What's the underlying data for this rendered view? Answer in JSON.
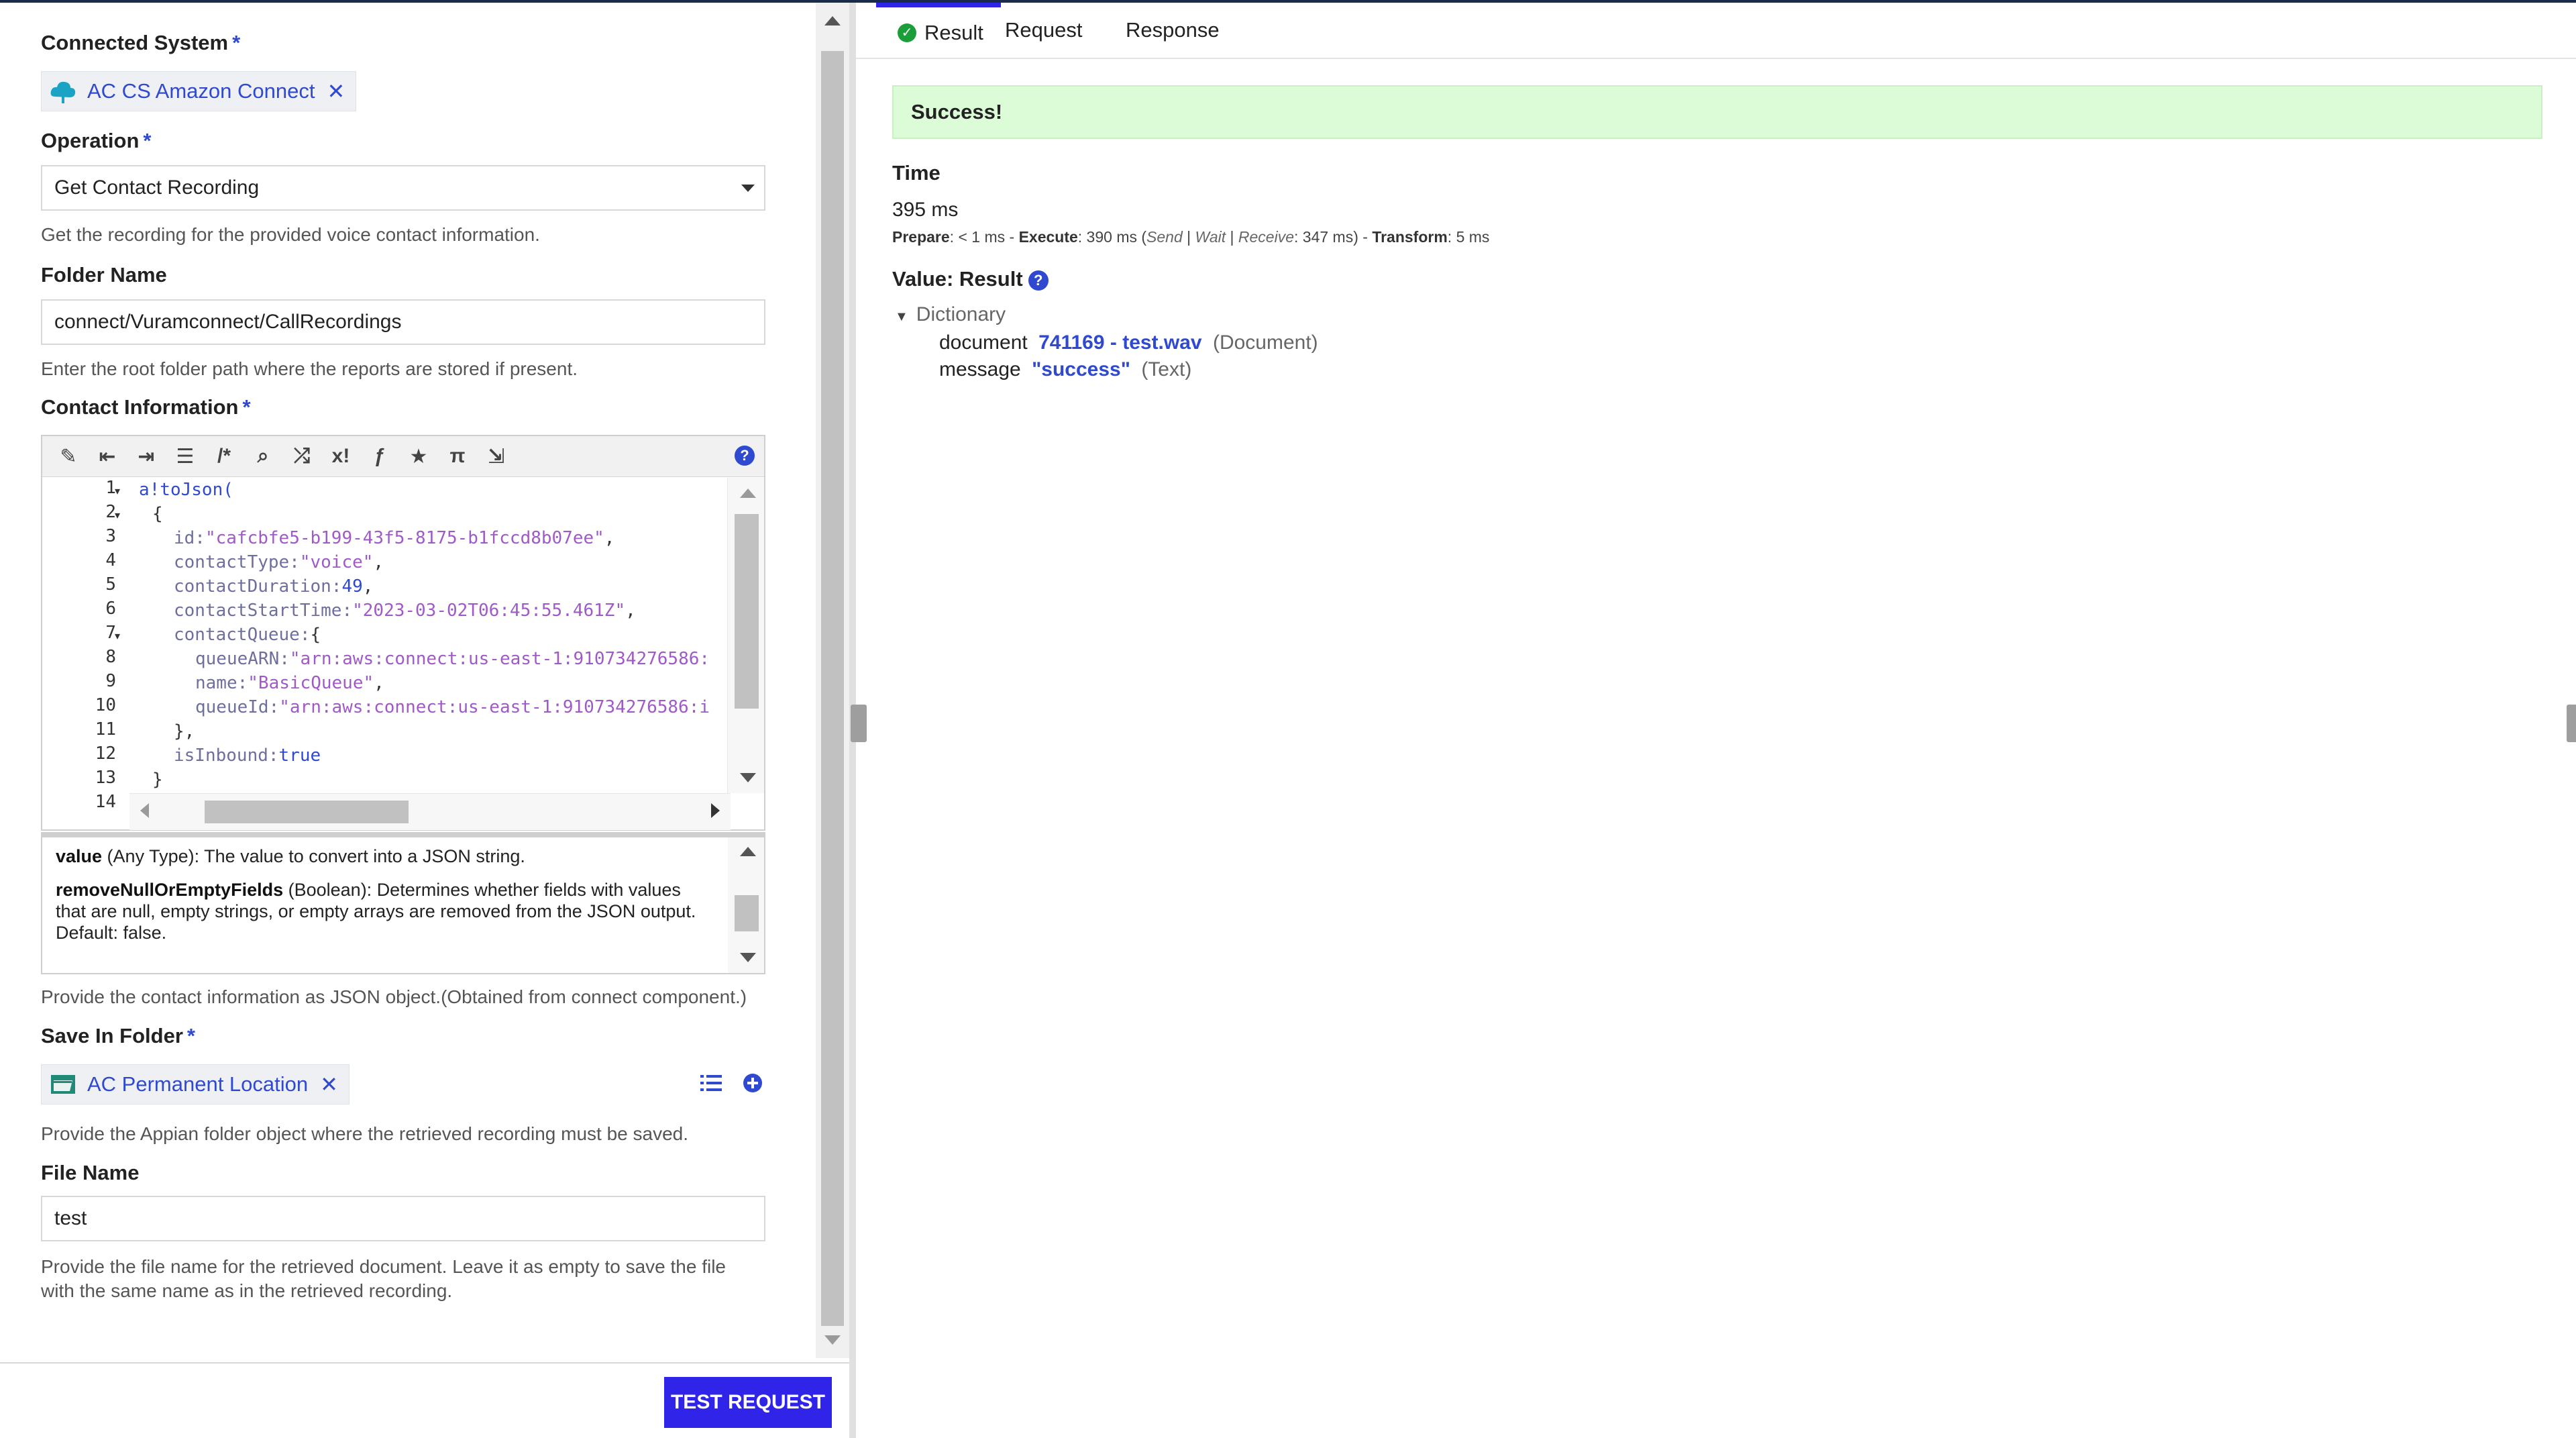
{
  "left": {
    "connected_system": {
      "label": "Connected System",
      "required": "*",
      "value": "AC CS Amazon Connect"
    },
    "operation": {
      "label": "Operation",
      "required": "*",
      "value": "Get Contact Recording",
      "help": "Get the recording for the provided voice contact information."
    },
    "folder_name": {
      "label": "Folder Name",
      "value": "connect/Vuramconnect/CallRecordings",
      "help": "Enter the root folder path where the reports are stored if present."
    },
    "contact_information": {
      "label": "Contact Information",
      "required": "*",
      "toolbar": [
        "wand-icon",
        "outdent-icon",
        "indent-icon",
        "list-icon",
        "comment-icon",
        "search-icon",
        "shuffle-icon",
        "variable-icon",
        "function-icon",
        "star-icon",
        "pi-icon",
        "export-icon"
      ],
      "line_numbers": [
        "1",
        "2",
        "3",
        "4",
        "5",
        "6",
        "7",
        "8",
        "9",
        "10",
        "11",
        "12",
        "13",
        "14"
      ],
      "code": {
        "l1": "a!toJson(",
        "l2": "{",
        "l3_key": "id:",
        "l3_val": "\"cafcbfe5-b199-43f5-8175-b1fccd8b07ee\"",
        "l3_end": ",",
        "l4_key": "contactType:",
        "l4_val": "\"voice\"",
        "l4_end": ",",
        "l5_key": "contactDuration:",
        "l5_val": "49",
        "l5_end": ",",
        "l6_key": "contactStartTime:",
        "l6_val": "\"2023-03-02T06:45:55.461Z\"",
        "l6_end": ",",
        "l7_key": "contactQueue:",
        "l7_end": "{",
        "l8_key": "queueARN:",
        "l8_val": "\"arn:aws:connect:us-east-1:910734276586:",
        "l9_key": "name:",
        "l9_val": "\"BasicQueue\"",
        "l9_end": ",",
        "l10_key": "queueId:",
        "l10_val": "\"arn:aws:connect:us-east-1:910734276586:i",
        "l11": "},",
        "l12_key": "isInbound:",
        "l12_val": "true",
        "l13": "}",
        "l14": "`"
      },
      "doc": {
        "p1_name": "value",
        "p1_type": " (Any Type): ",
        "p1_desc": "The value to convert into a JSON string.",
        "p2_name": "removeNullOrEmptyFields",
        "p2_type": " (Boolean): ",
        "p2_desc": "Determines whether fields with values that are null, empty strings, or empty arrays are removed from the JSON output. Default: false."
      },
      "help": "Provide the contact information as JSON object.(Obtained from connect component.)"
    },
    "save_in_folder": {
      "label": "Save In Folder",
      "required": "*",
      "value": "AC Permanent Location",
      "help": "Provide the Appian folder object where the retrieved recording must be saved."
    },
    "file_name": {
      "label": "File Name",
      "value": "test",
      "help_line1": "Provide the file name for the retrieved document. Leave it as empty to save the file",
      "help_line2": "with the same name as in the retrieved recording."
    },
    "test_button": "TEST REQUEST"
  },
  "right": {
    "tabs": [
      {
        "label": "Result",
        "active": true
      },
      {
        "label": "Request"
      },
      {
        "label": "Response"
      }
    ],
    "status": "Success!",
    "time_label": "Time",
    "time_value": "395 ms",
    "timing": {
      "prepare_label": "Prepare",
      "prepare_val": ": < 1 ms - ",
      "execute_label": "Execute",
      "execute_val": ": 390 ms (",
      "send": "Send",
      "sep1": " | ",
      "wait": "Wait",
      "sep2": " | ",
      "receive": "Receive",
      "receive_val": ": 347 ms) - ",
      "transform_label": "Transform",
      "transform_val": ": 5 ms"
    },
    "value_label": "Value: Result",
    "tree": {
      "root": "Dictionary",
      "document_key": "document",
      "document_link": "741169 - test.wav",
      "document_type": "(Document)",
      "message_key": "message",
      "message_val": "\"success\"",
      "message_type": "(Text)"
    }
  },
  "colors": {
    "accent": "#2f24e8",
    "link": "#2f49d1",
    "success_bg": "#dcfcd8",
    "success_check": "#1a9e3a"
  }
}
